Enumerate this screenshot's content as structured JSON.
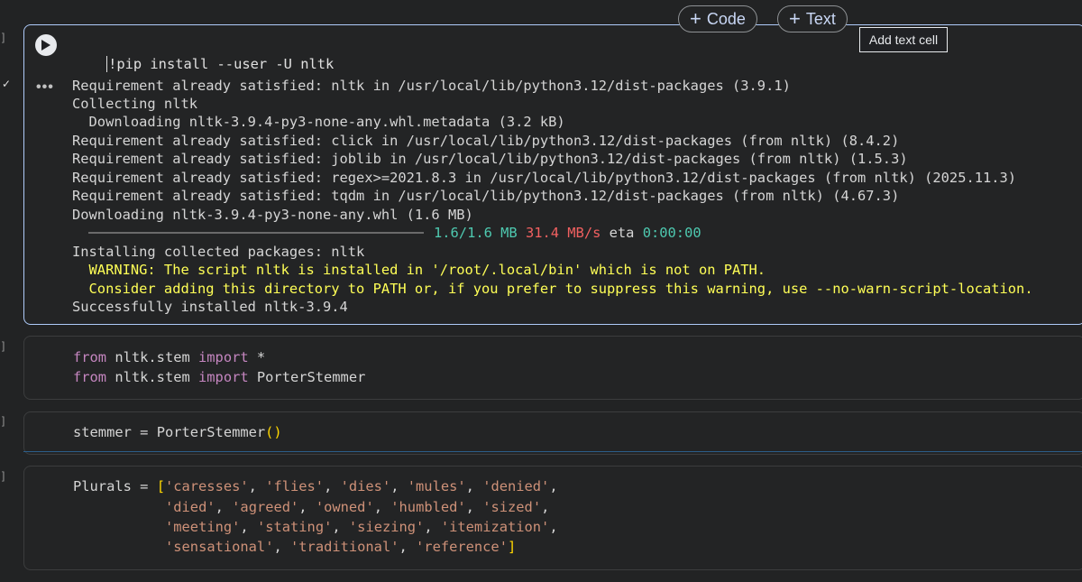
{
  "toolbar": {
    "add_code_label": "Code",
    "add_text_label": "Text",
    "tooltip": "Add text cell"
  },
  "gutter": {
    "bracket": "]",
    "done_mark": "✓"
  },
  "cell1": {
    "source": "!pip install --user -U nltk",
    "output_menu": "•••",
    "output": {
      "l1": "Requirement already satisfied: nltk in /usr/local/lib/python3.12/dist-packages (3.9.1)",
      "l2": "Collecting nltk",
      "l3": "  Downloading nltk-3.9.4-py3-none-any.whl.metadata (3.2 kB)",
      "l4": "Requirement already satisfied: click in /usr/local/lib/python3.12/dist-packages (from nltk) (8.4.2)",
      "l5": "Requirement already satisfied: joblib in /usr/local/lib/python3.12/dist-packages (from nltk) (1.5.3)",
      "l6": "Requirement already satisfied: regex>=2021.8.3 in /usr/local/lib/python3.12/dist-packages (from nltk) (2025.11.3)",
      "l7": "Requirement already satisfied: tqdm in /usr/local/lib/python3.12/dist-packages (from nltk) (4.67.3)",
      "l8": "Downloading nltk-3.9.4-py3-none-any.whl (1.6 MB)",
      "progress_size": "1.6/1.6 MB",
      "progress_speed": "31.4 MB/s",
      "progress_eta_label": "eta",
      "progress_eta": "0:00:00",
      "progress_fraction": 1.0,
      "l10": "Installing collected packages: nltk",
      "warn1": "  WARNING: The script nltk is installed in '/root/.local/bin' which is not on PATH.",
      "warn2": "  Consider adding this directory to PATH or, if you prefer to suppress this warning, use --no-warn-script-location.",
      "l13": "Successfully installed nltk-3.9.4"
    }
  },
  "cell2": {
    "line1": {
      "from": "from",
      "module": " nltk.stem ",
      "import": "import",
      "rest": " *"
    },
    "line2": {
      "from": "from",
      "module": " nltk.stem ",
      "import": "import",
      "rest": " PorterStemmer"
    }
  },
  "cell3": {
    "var": "stemmer",
    "eq": " = ",
    "call": "PorterStemmer",
    "parens": "()"
  },
  "cell4": {
    "var": "Plurals",
    "eq": " = ",
    "open": "[",
    "close": "]",
    "comma": ",",
    "row1": [
      "'caresses'",
      "'flies'",
      "'dies'",
      "'mules'",
      "'denied'"
    ],
    "row2": [
      "'died'",
      "'agreed'",
      "'owned'",
      "'humbled'",
      "'sized'"
    ],
    "row3": [
      "'meeting'",
      "'stating'",
      "'siezing'",
      "'itemization'"
    ],
    "row4": [
      "'sensational'",
      "'traditional'",
      "'reference'"
    ]
  },
  "colors": {
    "keyword": "#c586c0",
    "string": "#ce9178",
    "bracket": "#ffd700",
    "warning": "#ffff56",
    "focus_border": "#aecbfa"
  }
}
